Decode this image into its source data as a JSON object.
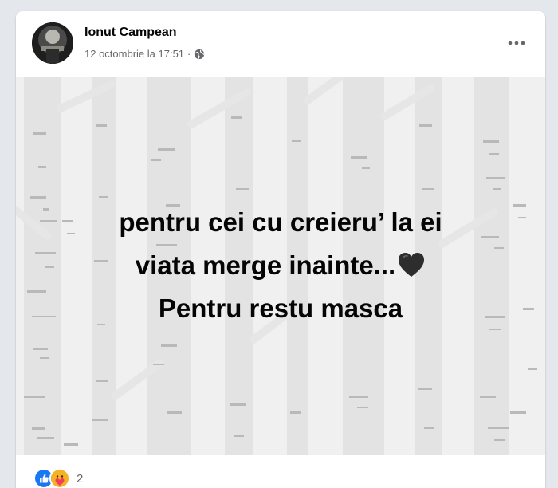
{
  "post": {
    "author": "Ionut Campean",
    "timestamp": "12 octombrie la 17:51",
    "separator": "·",
    "privacy_icon": "globe-icon",
    "menu_icon": "more-options-icon",
    "text_lines": [
      "pentru cei cu creieru’ la ei",
      "viata merge inainte...",
      "Pentru restu masca"
    ],
    "emoji": "black-heart-icon",
    "reactions": {
      "icons": [
        "like-reaction-icon",
        "care-reaction-icon"
      ],
      "count": "2"
    }
  },
  "colors": {
    "like_blue": "#1877f2",
    "care_yellow": "#f7b125",
    "text_primary": "#050505",
    "text_secondary": "#65676b"
  }
}
